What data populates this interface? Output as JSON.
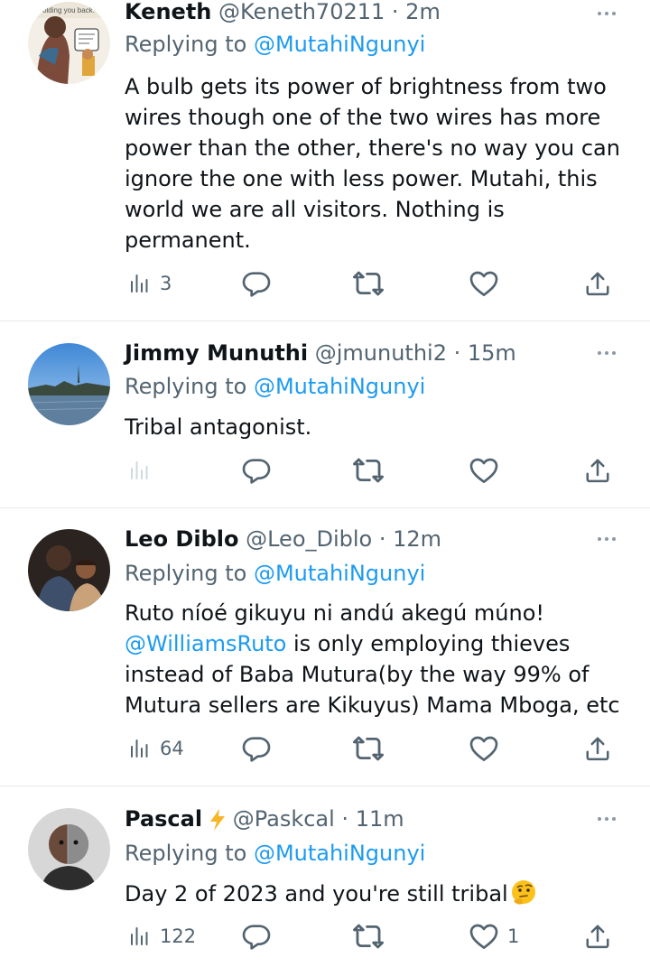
{
  "tweets": [
    {
      "name": "Keneth",
      "handle": "@Keneth70211",
      "sep": "·",
      "time": "2m",
      "replying_prefix": "Replying to ",
      "replying_to": "@MutahiNgunyi",
      "body_lines": [
        "A bulb gets its power of brightness from two",
        "wires though one of the two wires has more",
        "power than the other, there's no way you can",
        "ignore the one with less power. Mutahi, this",
        "world we are all visitors. Nothing is",
        "permanent."
      ],
      "views": "3",
      "likes": "",
      "avatar_caption": "olding you back."
    },
    {
      "name": "Jimmy Munuthi",
      "handle": "@jmunuthi2",
      "sep": "·",
      "time": "15m",
      "replying_prefix": "Replying to ",
      "replying_to": "@MutahiNgunyi",
      "body_lines": [
        "Tribal antagonist."
      ],
      "views": "",
      "likes": ""
    },
    {
      "name": "Leo Diblo",
      "handle": "@Leo_Diblo",
      "sep": "·",
      "time": "12m",
      "replying_prefix": "Replying to ",
      "replying_to": "@MutahiNgunyi",
      "body_line1": "Ruto níoé gikuyu ni andú akegú múno!",
      "body_mention": "@WilliamsRuto",
      "body_line2_rest": " is only employing thieves",
      "body_line3": "instead of Baba Mutura(by the way 99% of",
      "body_line4": "Mutura sellers are Kikuyus) Mama Mboga, etc",
      "views": "64",
      "likes": ""
    },
    {
      "name": "Pascal",
      "handle": "@Paskcal",
      "sep": "·",
      "time": "11m",
      "replying_prefix": "Replying to ",
      "replying_to": "@MutahiNgunyi",
      "body_lines": [
        "Day 2 of 2023 and you're still tribal"
      ],
      "views": "122",
      "likes": "1"
    }
  ],
  "icons": {
    "views": "bar-chart-icon",
    "reply": "speech-bubble-icon",
    "retweet": "retweet-icon",
    "like": "heart-icon",
    "share": "share-upload-icon",
    "more": "more-dots-icon",
    "lightning": "lightning-emoji",
    "thinking": "thinking-face-emoji"
  },
  "colors": {
    "link": "#1d9bf0",
    "secondary": "#536471",
    "icon": "#536471",
    "divider": "#e6e9ec"
  }
}
